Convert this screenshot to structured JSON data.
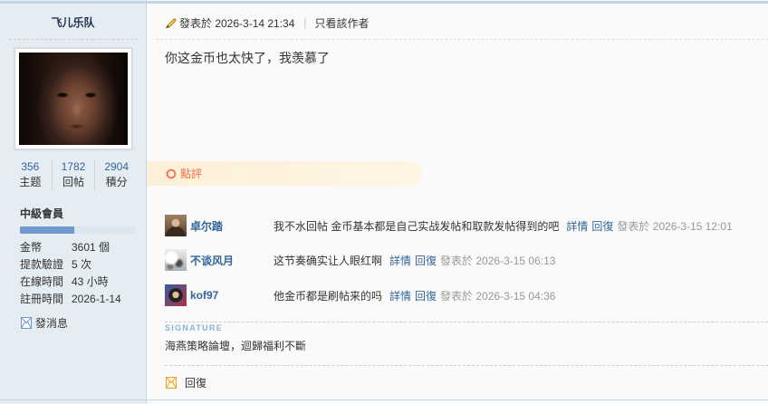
{
  "author": {
    "username": "飞儿乐队",
    "stats": [
      {
        "value": "356",
        "label": "主题"
      },
      {
        "value": "1782",
        "label": "回帖"
      },
      {
        "value": "2904",
        "label": "積分"
      }
    ],
    "rank": "中級會員",
    "level_progress": 0.47,
    "profile": [
      {
        "label": "金幣",
        "value": "3601 個"
      },
      {
        "label": "提款驗證",
        "value": "5 次"
      },
      {
        "label": "在線時間",
        "value": "43 小時"
      },
      {
        "label": "註冊時間",
        "value": "2026-1-14"
      }
    ],
    "message_label": "發消息",
    "message_icon": "envelope-icon"
  },
  "post": {
    "time_icon": "pencil-icon",
    "posted_at": "發表於 2026-3-14 21:34",
    "separator": "|",
    "only_author_label": "只看該作者",
    "content": "你这金币也太快了，我羡慕了"
  },
  "rate": {
    "icon": "circle-icon",
    "label": "點評",
    "comments": [
      {
        "user": "卓尔踏",
        "text": "我不水回帖 金币基本都是自己实战发帖和取款发帖得到的吧",
        "details_label": "詳情",
        "reply_label": "回復",
        "posted_at": "發表於 2026-3-15 12:01"
      },
      {
        "user": "不谈风月",
        "text": "这节奏确实让人眼红啊",
        "details_label": "詳情",
        "reply_label": "回復",
        "posted_at": "發表於 2026-3-15 06:13"
      },
      {
        "user": "kof97",
        "text": "他金币都是刷帖来的吗",
        "details_label": "詳情",
        "reply_label": "回復",
        "posted_at": "發表於 2026-3-15 04:36"
      }
    ]
  },
  "signature": {
    "heading": "SIGNATURE",
    "text": "海燕策略論壇，迴歸福利不斷"
  },
  "footer": {
    "reply_icon": "reply-icon",
    "reply_label": "回復"
  },
  "colors": {
    "sidebar_bg": "#E5EDF2",
    "border": "#C2D5E3",
    "link": "#336699",
    "rate_accent": "#F26C4F",
    "rate_bg": "#FDF0D8",
    "muted": "#999999",
    "signature_heading": "#8DB3D3",
    "progress_fill": "#6F99CF",
    "main_bg": "#FAFAFA",
    "username": "#1F3152"
  }
}
